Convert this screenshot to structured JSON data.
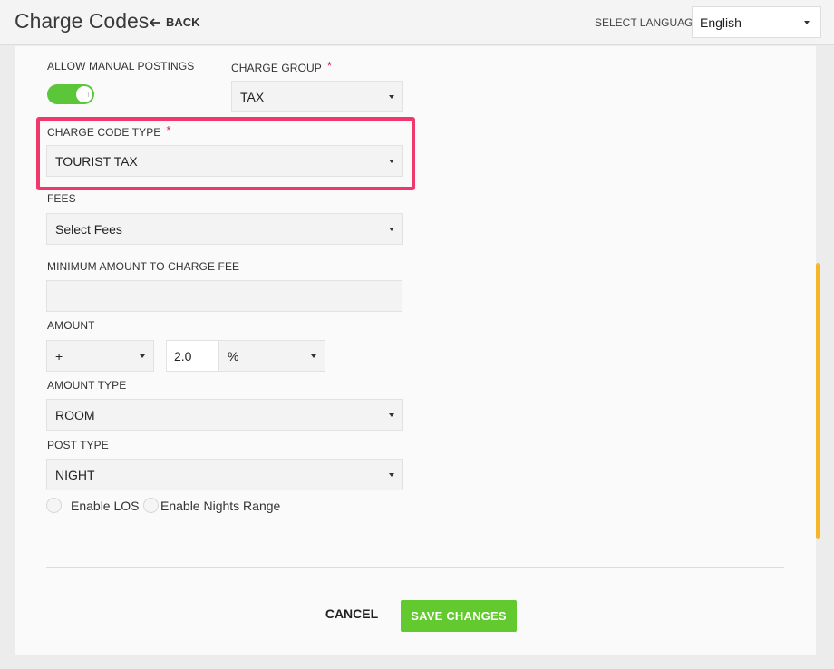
{
  "header": {
    "title": "Charge Codes",
    "back_label": "BACK",
    "language_label": "SELECT LANGUAGE",
    "language_value": "English"
  },
  "form": {
    "allow_manual_postings": {
      "label": "ALLOW MANUAL POSTINGS",
      "enabled": true
    },
    "charge_group": {
      "label": "CHARGE GROUP",
      "required_mark": "*",
      "value": "TAX"
    },
    "charge_code_type": {
      "label": "CHARGE CODE TYPE",
      "required_mark": "*",
      "value": "TOURIST TAX"
    },
    "fees": {
      "label": "FEES",
      "value": "Select Fees"
    },
    "minimum_amount": {
      "label": "MINIMUM AMOUNT TO CHARGE FEE",
      "value": ""
    },
    "amount": {
      "label": "AMOUNT",
      "sign": "+",
      "value": "2.0",
      "unit": "%"
    },
    "amount_type": {
      "label": "AMOUNT TYPE",
      "value": "ROOM"
    },
    "post_type": {
      "label": "POST TYPE",
      "value": "NIGHT"
    },
    "enable_los": {
      "label": "Enable LOS",
      "checked": false
    },
    "enable_nights_range": {
      "label": "Enable Nights Range",
      "checked": false
    }
  },
  "actions": {
    "cancel_label": "CANCEL",
    "save_label": "SAVE CHANGES"
  },
  "colors": {
    "toggle_on": "#5bc63a",
    "highlight": "#f0386c",
    "required": "#e0204e",
    "save_button": "#62c92f",
    "scrollbar": "#f5b62a"
  }
}
